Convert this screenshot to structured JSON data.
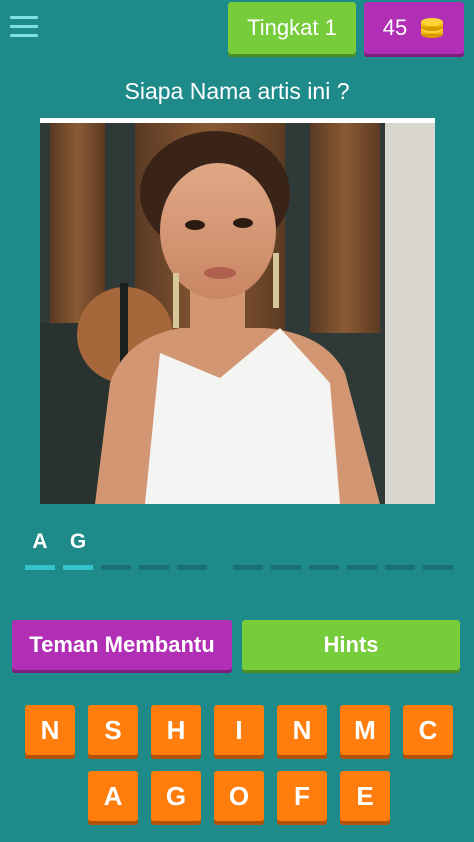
{
  "header": {
    "level_label": "Tingkat 1",
    "coins": "45"
  },
  "question": "Siapa Nama artis ini ?",
  "answer_slots": [
    "A",
    "G",
    "",
    "",
    "",
    "",
    "",
    "",
    "",
    "",
    "",
    ""
  ],
  "buttons": {
    "help_label": "Teman Membantu",
    "hints_label": "Hints"
  },
  "letters": {
    "row1": [
      "N",
      "S",
      "H",
      "I",
      "N",
      "M",
      "C"
    ],
    "row2": [
      "A",
      "G",
      "O",
      "F",
      "E"
    ]
  },
  "colors": {
    "background": "#1f8a8a",
    "green": "#76cc3b",
    "purple": "#b02fb5",
    "orange": "#ff7d0d"
  },
  "icons": {
    "menu": "hamburger-menu-icon",
    "coins": "coin-stack-icon"
  }
}
